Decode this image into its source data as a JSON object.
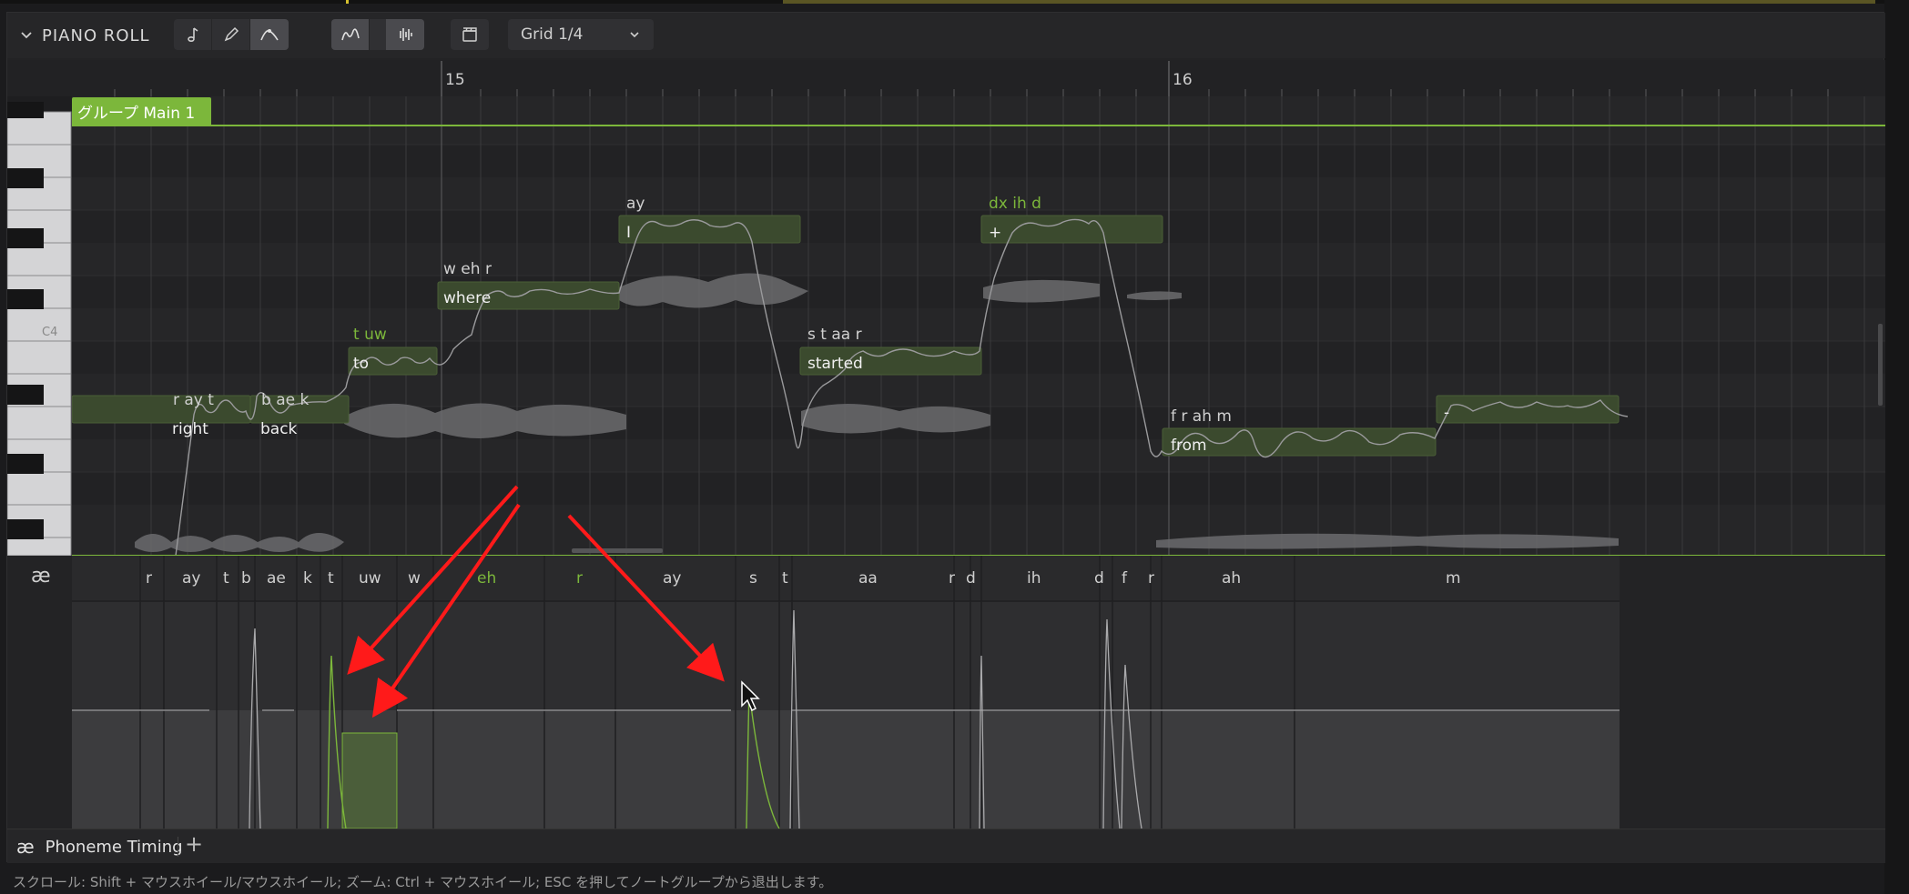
{
  "toolbar": {
    "title": "PIANO ROLL",
    "grid_label": "Grid 1/4",
    "icons": [
      "note-icon",
      "pencil-icon",
      "curve-select-icon",
      "pitch-curve-icon",
      "waveform-icon",
      "clapper-icon"
    ]
  },
  "ruler": {
    "markers": [
      "15",
      "16"
    ]
  },
  "group_label": "グループ Main 1",
  "key_label": "C4",
  "notes": [
    {
      "lyric": "right",
      "phonemes": "r ay t"
    },
    {
      "lyric": "back",
      "phonemes": "b ae k"
    },
    {
      "lyric": "to",
      "phonemes": "t uw"
    },
    {
      "lyric": "where",
      "phonemes": "w eh r"
    },
    {
      "lyric": "I",
      "phonemes": "ay"
    },
    {
      "lyric": "started",
      "phonemes": "s t aa r"
    },
    {
      "lyric": "+",
      "phonemes": "dx ih d"
    },
    {
      "lyric": "from",
      "phonemes": "f r ah m"
    },
    {
      "lyric": "-",
      "phonemes": ""
    }
  ],
  "phoneme_row": {
    "icon": "ae-ligature-icon",
    "symbol": "æ",
    "items": [
      "r",
      "ay",
      "t",
      "b",
      "ae",
      "k",
      "t",
      "uw",
      "w",
      "eh",
      "r",
      "ay",
      "s",
      "t",
      "aa",
      "r",
      "d",
      "ih",
      "d",
      "f",
      "r",
      "ah",
      "m"
    ]
  },
  "tab": {
    "symbol": "æ",
    "label": "Phoneme Timing",
    "add": "+"
  },
  "status": "スクロール: Shift + マウスホイール/マウスホイール; ズーム: Ctrl + マウスホイール; ESC を押してノートグループから退出します。",
  "colors": {
    "accent": "#7cb73b",
    "note": "#3b4a2e",
    "arrow": "#ff1a1a"
  }
}
